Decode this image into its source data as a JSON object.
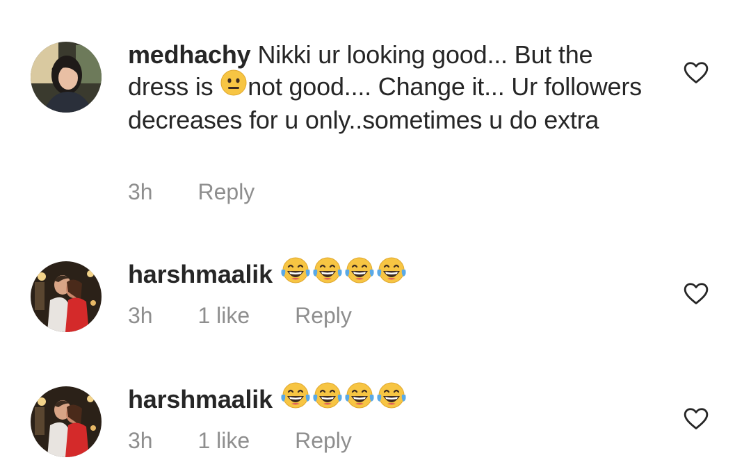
{
  "comments": [
    {
      "username": "medhachy",
      "text_before_emoji": "Nikki ur looking good... But the dress is ",
      "emoji": "neutral-face",
      "text_after_emoji": "not good.... Change it... Ur followers decreases for u only..sometimes u do extra",
      "time": "3h",
      "likes": "",
      "reply_label": "Reply"
    },
    {
      "username": "harshmaalik",
      "emoji": "face-with-tears-of-joy",
      "emoji_count": 4,
      "time": "3h",
      "likes": "1 like",
      "reply_label": "Reply"
    },
    {
      "username": "harshmaalik",
      "emoji": "face-with-tears-of-joy",
      "emoji_count": 4,
      "time": "3h",
      "likes": "1 like",
      "reply_label": "Reply"
    }
  ],
  "colors": {
    "text": "#262626",
    "meta": "#8e8e8e",
    "emoji_yellow": "#f7c543"
  }
}
